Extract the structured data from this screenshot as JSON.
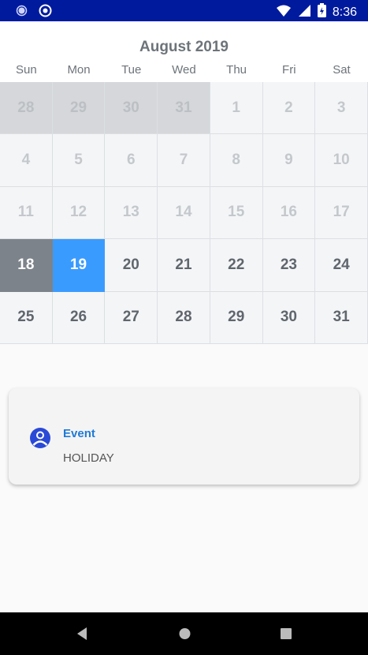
{
  "status_bar": {
    "time": "8:36",
    "icons": [
      "notification-dot-icon",
      "chrome-icon",
      "wifi-icon",
      "signal-icon",
      "battery-charging-icon"
    ]
  },
  "calendar": {
    "month_title": "August 2019",
    "weekdays": [
      "Sun",
      "Mon",
      "Tue",
      "Wed",
      "Thu",
      "Fri",
      "Sat"
    ],
    "weeks": [
      [
        "28",
        "29",
        "30",
        "31",
        "1",
        "2",
        "3"
      ],
      [
        "4",
        "5",
        "6",
        "7",
        "8",
        "9",
        "10"
      ],
      [
        "11",
        "12",
        "13",
        "14",
        "15",
        "16",
        "17"
      ],
      [
        "18",
        "19",
        "20",
        "21",
        "22",
        "23",
        "24"
      ],
      [
        "25",
        "26",
        "27",
        "28",
        "29",
        "30",
        "31"
      ]
    ],
    "today": "18",
    "selected": "19"
  },
  "event": {
    "title": "Event",
    "description": "HOLIDAY",
    "icon": "person-circle-icon"
  },
  "nav_bar": {
    "buttons": [
      "back-icon",
      "home-icon",
      "recents-icon"
    ]
  },
  "colors": {
    "status_bar": "#001a9e",
    "selected": "#3a9bff",
    "today": "#7c838a",
    "event_title": "#1f7ad6"
  }
}
